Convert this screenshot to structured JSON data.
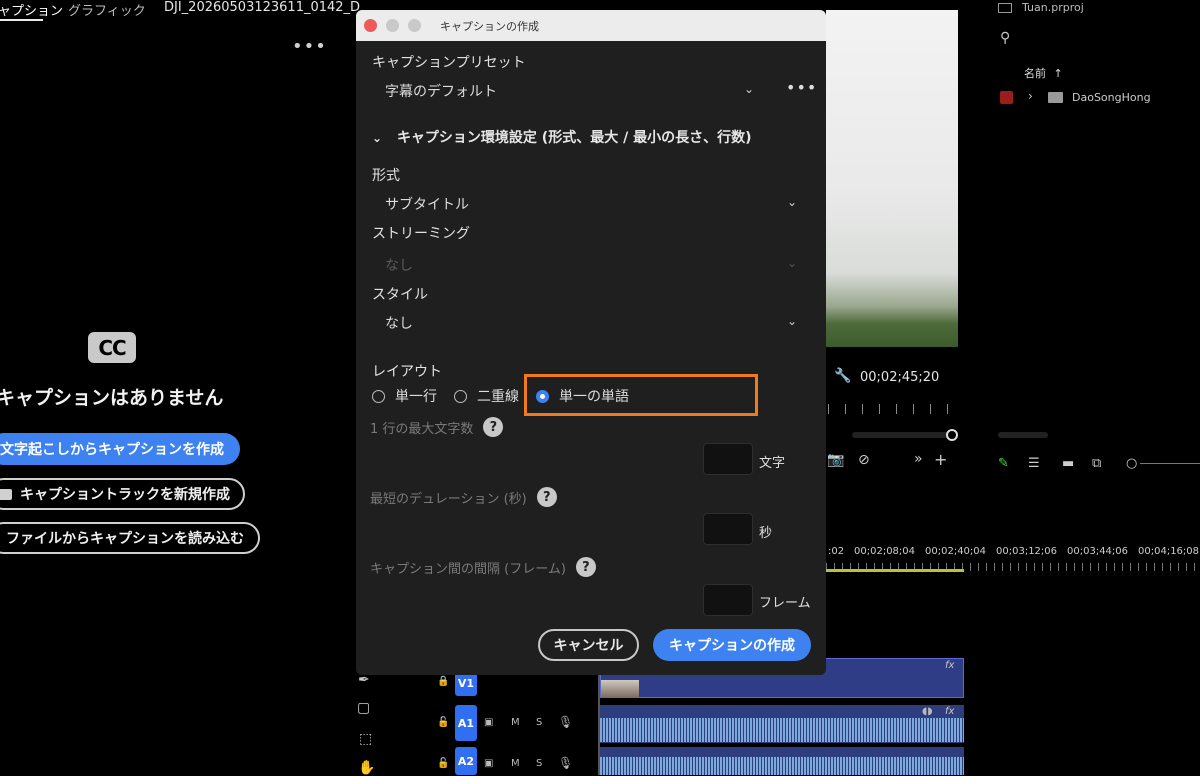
{
  "left_panel": {
    "tabs": [
      "ャプション",
      "グラフィック",
      "DJI_20260503123611_0142_D"
    ],
    "cc_badge": "CC",
    "empty_message": "キャプションはありません",
    "buttons": {
      "from_transcript": "文字起こしからキャプションを作成",
      "new_track": "キャプショントラックを新規作成",
      "import_file": "ファイルからキャプションを読み込む"
    }
  },
  "dialog": {
    "title": "キャプションの作成",
    "preset_label": "キャプションプリセット",
    "preset_value": "字幕のデフォルト",
    "settings_section": "キャプション環境設定 (形式、最大 / 最小の長さ、行数)",
    "format": {
      "label": "形式",
      "value": "サブタイトル"
    },
    "streaming": {
      "label": "ストリーミング",
      "value": "なし"
    },
    "style": {
      "label": "スタイル",
      "value": "なし"
    },
    "layout": {
      "label": "レイアウト",
      "options": [
        "単一行",
        "二重線",
        "単一の単語"
      ],
      "selected": "単一の単語"
    },
    "max_chars": {
      "label": "1 行の最大文字数",
      "unit": "文字"
    },
    "min_duration": {
      "label": "最短のデュレーション (秒)",
      "unit": "秒"
    },
    "gap_frames": {
      "label": "キャプション間の間隔 (フレーム)",
      "unit": "フレーム"
    },
    "cancel_label": "キャンセル",
    "create_label": "キャプションの作成",
    "accent": "#3d82f0",
    "highlight": "#f07a1e"
  },
  "monitor": {
    "timecode": "00;02;45;20"
  },
  "project": {
    "name": "Tuan.prproj",
    "name_column": "名前",
    "sort_indicator": "↑",
    "bin_name": "DaoSongHong"
  },
  "timeline": {
    "ruler_labels": [
      ":02",
      "00;02;08;04",
      "00;02;40;04",
      "00;03;12;06",
      "00;03;44;06",
      "00;04;16;08"
    ],
    "tracks": [
      "V1",
      "A1",
      "A2"
    ],
    "track_toggles": [
      "M",
      "S"
    ],
    "fx": "fx"
  }
}
